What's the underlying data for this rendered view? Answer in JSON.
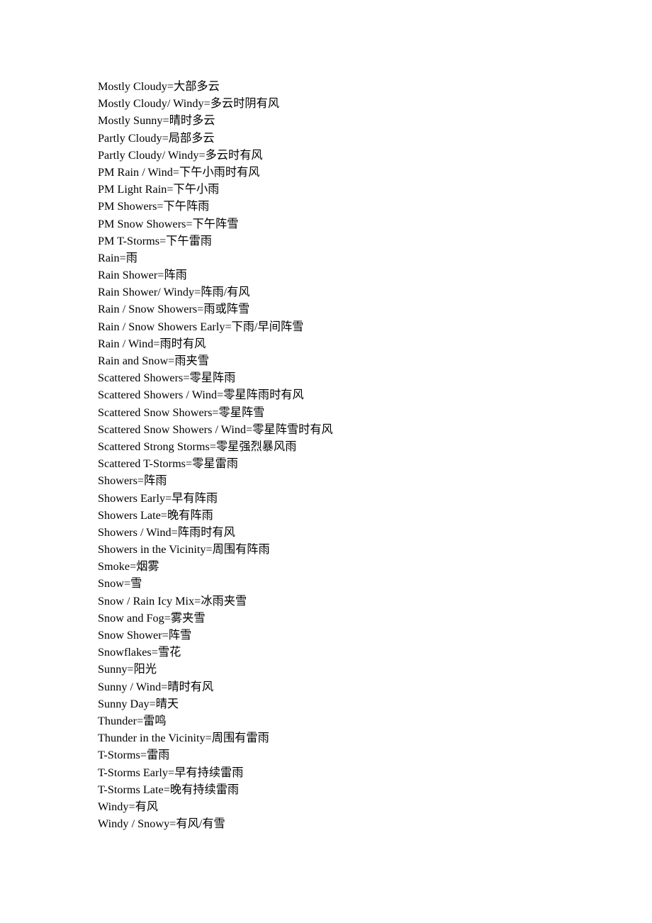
{
  "document": {
    "background_color": "#ffffff",
    "text_color": "#000000",
    "entry_count": 44,
    "entries": [
      {
        "id": 1,
        "text": "Mostly Cloudy=大部多云"
      },
      {
        "id": 2,
        "text": "Mostly Cloudy/ Windy=多云时阴有风"
      },
      {
        "id": 3,
        "text": "Mostly Sunny=晴时多云"
      },
      {
        "id": 4,
        "text": "Partly Cloudy=局部多云"
      },
      {
        "id": 5,
        "text": "Partly Cloudy/ Windy=多云时有风"
      },
      {
        "id": 6,
        "text": "PM Rain / Wind=下午小雨时有风"
      },
      {
        "id": 7,
        "text": "PM Light Rain=下午小雨"
      },
      {
        "id": 8,
        "text": "PM Showers=下午阵雨"
      },
      {
        "id": 9,
        "text": "PM Snow Showers=下午阵雪"
      },
      {
        "id": 10,
        "text": "PM T-Storms=下午雷雨"
      },
      {
        "id": 11,
        "text": "Rain=雨"
      },
      {
        "id": 12,
        "text": "Rain Shower=阵雨"
      },
      {
        "id": 13,
        "text": "Rain Shower/ Windy=阵雨/有风"
      },
      {
        "id": 14,
        "text": "Rain / Snow Showers=雨或阵雪"
      },
      {
        "id": 15,
        "text": "Rain / Snow Showers Early=下雨/早间阵雪"
      },
      {
        "id": 16,
        "text": "Rain / Wind=雨时有风"
      },
      {
        "id": 17,
        "text": "Rain and Snow=雨夹雪"
      },
      {
        "id": 18,
        "text": "Scattered Showers=零星阵雨"
      },
      {
        "id": 19,
        "text": "Scattered Showers / Wind=零星阵雨时有风"
      },
      {
        "id": 20,
        "text": "Scattered Snow Showers=零星阵雪"
      },
      {
        "id": 21,
        "text": "Scattered Snow Showers / Wind=零星阵雪时有风"
      },
      {
        "id": 22,
        "text": "Scattered Strong Storms=零星强烈暴风雨"
      },
      {
        "id": 23,
        "text": "Scattered T-Storms=零星雷雨"
      },
      {
        "id": 24,
        "text": "Showers=阵雨"
      },
      {
        "id": 25,
        "text": "Showers Early=早有阵雨"
      },
      {
        "id": 26,
        "text": "Showers Late=晚有阵雨"
      },
      {
        "id": 27,
        "text": "Showers / Wind=阵雨时有风"
      },
      {
        "id": 28,
        "text": "Showers in the Vicinity=周围有阵雨"
      },
      {
        "id": 29,
        "text": "Smoke=烟雾"
      },
      {
        "id": 30,
        "text": "Snow=雪"
      },
      {
        "id": 31,
        "text": "Snow / Rain Icy Mix=冰雨夹雪"
      },
      {
        "id": 32,
        "text": "Snow and Fog=雾夹雪"
      },
      {
        "id": 33,
        "text": "Snow Shower=阵雪"
      },
      {
        "id": 34,
        "text": "Snowflakes=雪花"
      },
      {
        "id": 35,
        "text": "Sunny=阳光"
      },
      {
        "id": 36,
        "text": "Sunny / Wind=晴时有风"
      },
      {
        "id": 37,
        "text": "Sunny Day=晴天"
      },
      {
        "id": 38,
        "text": "Thunder=雷鸣"
      },
      {
        "id": 39,
        "text": "Thunder in the Vicinity=周围有雷雨"
      },
      {
        "id": 40,
        "text": "T-Storms=雷雨"
      },
      {
        "id": 41,
        "text": "T-Storms Early=早有持续雷雨"
      },
      {
        "id": 42,
        "text": "T-Storms Late=晚有持续雷雨"
      },
      {
        "id": 43,
        "text": "Windy=有风"
      },
      {
        "id": 44,
        "text": "Windy / Snowy=有风/有雪"
      }
    ]
  }
}
